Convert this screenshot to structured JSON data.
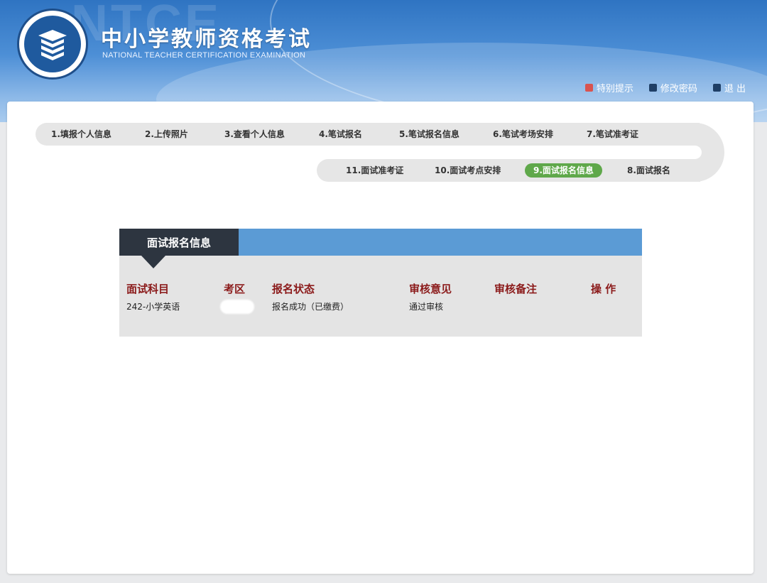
{
  "header": {
    "watermark": "NTCE",
    "title": "中小学教师资格考试",
    "subtitle": "NATIONAL TEACHER CERTIFICATION EXAMINATION",
    "links": [
      {
        "label": "特别提示",
        "icon": "notice-icon",
        "color": "#d9534f"
      },
      {
        "label": "修改密码",
        "icon": "password-icon",
        "color": "#1f3f66"
      },
      {
        "label": "退 出",
        "icon": "logout-icon",
        "color": "#1f3f66"
      }
    ]
  },
  "steps_row1": [
    {
      "label": "1.填报个人信息"
    },
    {
      "label": "2.上传照片"
    },
    {
      "label": "3.查看个人信息"
    },
    {
      "label": "4.笔试报名"
    },
    {
      "label": "5.笔试报名信息"
    },
    {
      "label": "6.笔试考场安排"
    },
    {
      "label": "7.笔试准考证"
    }
  ],
  "steps_row2": [
    {
      "label": "11.面试准考证"
    },
    {
      "label": "10.面试考点安排"
    },
    {
      "label": "9.面试报名信息",
      "active": true
    },
    {
      "label": "8.面试报名"
    }
  ],
  "section": {
    "tab_label": "面试报名信息",
    "columns": [
      "面试科目",
      "考区",
      "报名状态",
      "审核意见",
      "审核备注",
      "操 作"
    ],
    "rows": [
      {
        "subject": "242-小学英语",
        "region": "",
        "status": "报名成功（已缴费）",
        "review": "通过审核",
        "note": "",
        "action": ""
      }
    ]
  },
  "colors": {
    "header_blue": "#2f74c2",
    "active_step": "#5fa84a",
    "column_header": "#8b1a1a",
    "tab_dark": "#2d3540",
    "bar_blue": "#5b9bd5"
  }
}
